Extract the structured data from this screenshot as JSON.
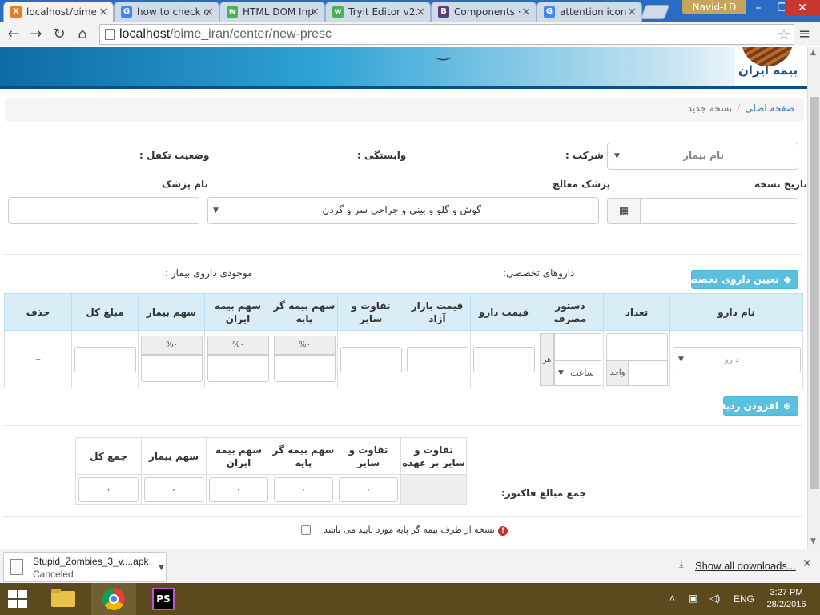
{
  "browser": {
    "tabs": [
      {
        "title": "localhost/bime",
        "favicon_color": "#e67e22",
        "favicon_glyph": "X"
      },
      {
        "title": "how to check c",
        "favicon_color": "#4285f4",
        "favicon_glyph": "G"
      },
      {
        "title": "HTML DOM Inp",
        "favicon_color": "#4caf50",
        "favicon_glyph": "w"
      },
      {
        "title": "Tryit Editor v2.",
        "favicon_color": "#4caf50",
        "favicon_glyph": "w"
      },
      {
        "title": "Components ·",
        "favicon_color": "#563d7c",
        "favicon_glyph": "B"
      },
      {
        "title": "attention icon",
        "favicon_color": "#4285f4",
        "favicon_glyph": "G"
      }
    ],
    "user": "Navid-LD",
    "url_host": "localhost",
    "url_path": "/bime_iran/center/new-presc"
  },
  "banner": {
    "logo_text": "بیمه ایران"
  },
  "breadcrumb": {
    "home": "صفحه اصلی",
    "separator": "/",
    "current": "نسخه جدید"
  },
  "form": {
    "patient_select": "نام بیمار",
    "company_label": "شرکت :",
    "affiliation_label": "وابستگی :",
    "coverage_label": "وضعیت تکفل :",
    "rx_date_label": "تاریخ نسخه",
    "physician_label": "پزشک معالج",
    "physician_value": "گوش و گلو و بینی و جراحی سر و گردن",
    "doctor_name_label": "نام پزشک",
    "special_drugs_button": "تعیین داروی تخصصی",
    "special_drugs_label": "داروهای تخصصی:",
    "stock_label": "موجودی داروی بیمار :"
  },
  "drug_table": {
    "headers": [
      "نام دارو",
      "تعداد",
      "دستور مصرف",
      "قیمت دارو",
      "قیمت بازار آزاد",
      "تفاوت و سایر",
      "سهم بیمه گر پایه",
      "سهم بیمه ایران",
      "سهم بیمار",
      "مبلغ کل",
      "حذف"
    ],
    "drug_placeholder": "دارو",
    "unit_addon": "واحد",
    "per_addon": "هر",
    "hour_select": "ساعت",
    "percent_addon": "%۰",
    "delete_mark": "–"
  },
  "add_row_button": "افزودن ردیف",
  "totals": {
    "label": "جمع مبالغ فاکتور:",
    "headers": [
      "تفاوت و سایر بر عهده",
      "تفاوت و سایر",
      "سهم بیمه گر پایه",
      "سهم بیمه ایران",
      "سهم بیمار",
      "جمع کل"
    ],
    "values": [
      "",
      "۰",
      "۰",
      "۰",
      "۰",
      "۰"
    ]
  },
  "approval": {
    "text": "نسخه از طرف بیمه گر پایه مورد تایید می باشد"
  },
  "downloads": {
    "file_name": "Stupid_Zombies_3_v....apk",
    "status": "Canceled",
    "show_all": "Show all downloads..."
  },
  "taskbar": {
    "language": "ENG",
    "time": "3:27 PM",
    "date": "28/2/2016"
  }
}
